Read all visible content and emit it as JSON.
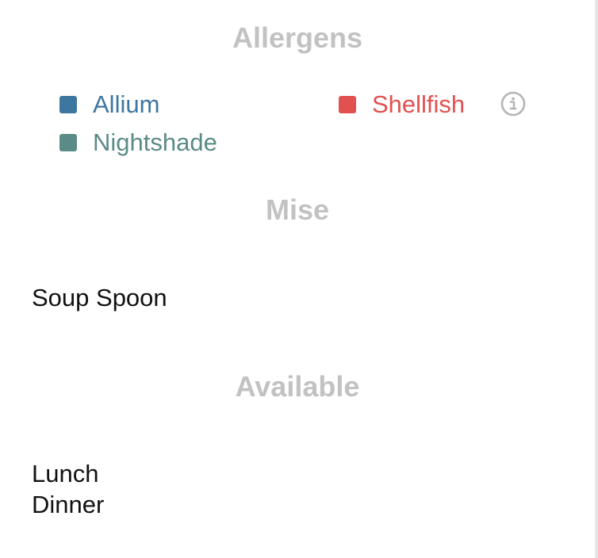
{
  "colors": {
    "heading": "#c2c2c2",
    "text": "#111111",
    "info_icon": "#b5b5b5"
  },
  "allergens": {
    "title": "Allergens",
    "items": [
      {
        "label": "Allium",
        "color": "#3d77a0"
      },
      {
        "label": "Shellfish",
        "color": "#e15150"
      },
      {
        "label": "Nightshade",
        "color": "#5b8b87"
      }
    ],
    "info_icon": "info-circle-icon"
  },
  "mise": {
    "title": "Mise",
    "items": [
      "Soup Spoon"
    ]
  },
  "available": {
    "title": "Available",
    "items": [
      "Lunch",
      "Dinner"
    ]
  }
}
